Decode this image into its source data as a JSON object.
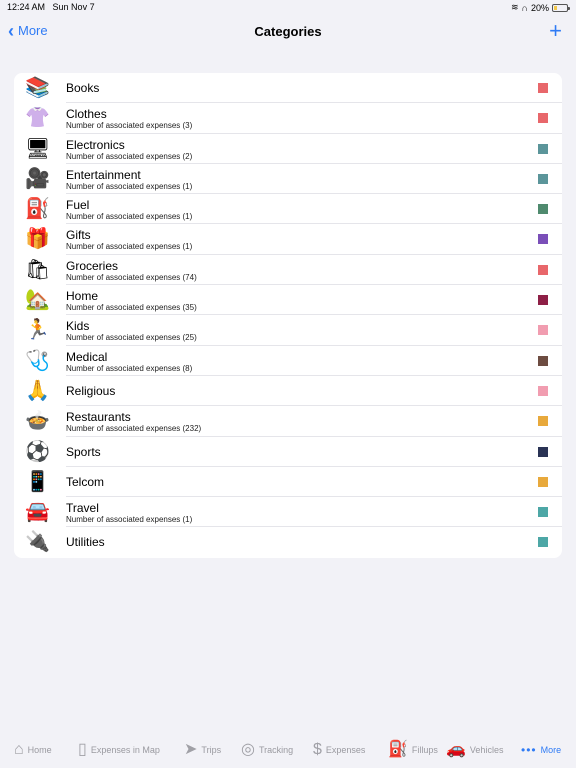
{
  "status": {
    "time": "12:24 AM",
    "date": "Sun Nov 7",
    "battery": "20%"
  },
  "nav": {
    "back_label": "More",
    "title": "Categories",
    "add_label": "+"
  },
  "categories": [
    {
      "icon": "📚",
      "name": "Books",
      "sub": "",
      "color": "#e8676b"
    },
    {
      "icon": "👚",
      "name": "Clothes",
      "sub": "Number of associated expenses (3)",
      "color": "#e8676b"
    },
    {
      "icon": "🖥",
      "name": "Electronics",
      "sub": "Number of associated expenses (2)",
      "color": "#5b959a"
    },
    {
      "icon": "🎥",
      "name": "Entertainment",
      "sub": "Number of associated expenses (1)",
      "color": "#5b959a"
    },
    {
      "icon": "⛽",
      "name": "Fuel",
      "sub": "Number of associated expenses (1)",
      "color": "#4f8a6e"
    },
    {
      "icon": "🎁",
      "name": "Gifts",
      "sub": "Number of associated expenses (1)",
      "color": "#7a4fb8"
    },
    {
      "icon": "🛍",
      "name": "Groceries",
      "sub": "Number of associated expenses (74)",
      "color": "#e8676b"
    },
    {
      "icon": "🏡",
      "name": "Home",
      "sub": "Number of associated expenses (35)",
      "color": "#8e2046"
    },
    {
      "icon": "🏃",
      "name": "Kids",
      "sub": "Number of associated expenses (25)",
      "color": "#f19db0"
    },
    {
      "icon": "🩺",
      "name": "Medical",
      "sub": "Number of associated expenses (8)",
      "color": "#6d4c41"
    },
    {
      "icon": "🙏",
      "name": "Religious",
      "sub": "",
      "color": "#f19db0"
    },
    {
      "icon": "🍲",
      "name": "Restaurants",
      "sub": "Number of associated expenses (232)",
      "color": "#e8a93c"
    },
    {
      "icon": "⚽",
      "name": "Sports",
      "sub": "",
      "color": "#2a3355"
    },
    {
      "icon": "📱",
      "name": "Telcom",
      "sub": "",
      "color": "#e8a93c"
    },
    {
      "icon": "🚘",
      "name": "Travel",
      "sub": "Number of associated expenses (1)",
      "color": "#4da7a6"
    },
    {
      "icon": "🔌",
      "name": "Utilities",
      "sub": "",
      "color": "#4da7a6"
    }
  ],
  "tabs": [
    {
      "label": "Home",
      "icon": "⌂",
      "icon_name": "house-icon"
    },
    {
      "label": "Expenses in Map",
      "icon": "▯",
      "icon_name": "map-icon"
    },
    {
      "label": "Trips",
      "icon": "➤",
      "icon_name": "paper-plane-icon"
    },
    {
      "label": "Tracking",
      "icon": "◎",
      "icon_name": "location-arrow-icon"
    },
    {
      "label": "Expenses",
      "icon": "$",
      "icon_name": "dollar-circle-icon"
    },
    {
      "label": "Fillups",
      "icon": "⛽",
      "icon_name": "fuel-pump-icon"
    },
    {
      "label": "Vehicles",
      "icon": "🚗",
      "icon_name": "car-icon"
    },
    {
      "label": "More",
      "icon": "•••",
      "icon_name": "ellipsis-icon"
    }
  ],
  "active_tab": "More"
}
